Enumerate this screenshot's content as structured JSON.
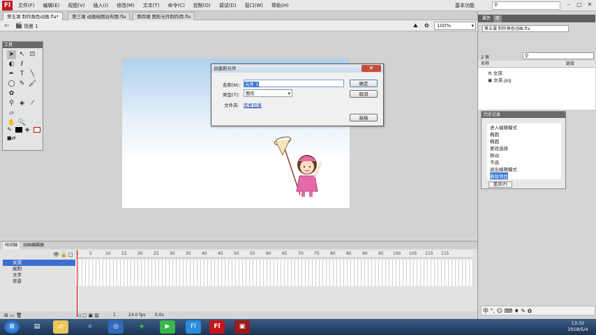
{
  "app": {
    "logo": "Fl"
  },
  "menu": [
    "文件(F)",
    "编辑(E)",
    "视图(V)",
    "插入(I)",
    "修改(M)",
    "文本(T)",
    "命令(C)",
    "控制(O)",
    "调试(D)",
    "窗口(W)",
    "帮助(H)"
  ],
  "workspace": "基本功能",
  "window_controls": [
    "–",
    "□",
    "✕"
  ],
  "doc_tabs": [
    "第五课 制作角色动画.fla*",
    "第三课 动画绘图台布图.fla",
    "第四课 图形元件制作用.fla"
  ],
  "scene": "场景 1",
  "zoom": "100%",
  "tools_title": "工具",
  "dialog": {
    "title": "创建新元件",
    "close": "✕",
    "name_label": "名称(N):",
    "name_value": "元件 1",
    "type_label": "类型(T):",
    "type_value": "图形",
    "folder_label": "文件夹:",
    "folder_value": "库根目录",
    "ok": "确定",
    "cancel": "取消",
    "advanced": "高级"
  },
  "timeline": {
    "tabs": [
      "时间轴",
      "动画编辑器"
    ],
    "ticks": [
      "1",
      "5",
      "10",
      "15",
      "20",
      "25",
      "30",
      "35",
      "40",
      "45",
      "50",
      "55",
      "60",
      "65",
      "70",
      "75",
      "80",
      "85",
      "90",
      "95",
      "100",
      "105",
      "110",
      "115"
    ],
    "layers": [
      "女孩",
      "绘制",
      "文字",
      "背景"
    ],
    "status": [
      "1",
      "24.0 fps",
      "0.0s"
    ]
  },
  "library": {
    "tabs": [
      "属性",
      "库"
    ],
    "file": "第五课 制作角色动画.fla",
    "count": "2 项",
    "col_name": "名称",
    "col_link": "链接",
    "items": [
      "女孩",
      "女孩.jpg"
    ]
  },
  "history": {
    "title": "历史记录",
    "items": [
      "进入编辑模式",
      "椭圆",
      "椭圆",
      "更改选择",
      "移动",
      "不选",
      "退出编辑模式",
      "删除项目"
    ],
    "replay": "重放(P)"
  },
  "ime": "中 °, ☺ ⌨ ♦ ✎ ✿",
  "clock": {
    "time": "13:32",
    "date": "2018/5/4"
  },
  "taskbar_apps": [
    "⊞",
    "▤",
    "📁",
    "e",
    "◎",
    "◈",
    "▶",
    "Fl",
    "▣"
  ]
}
